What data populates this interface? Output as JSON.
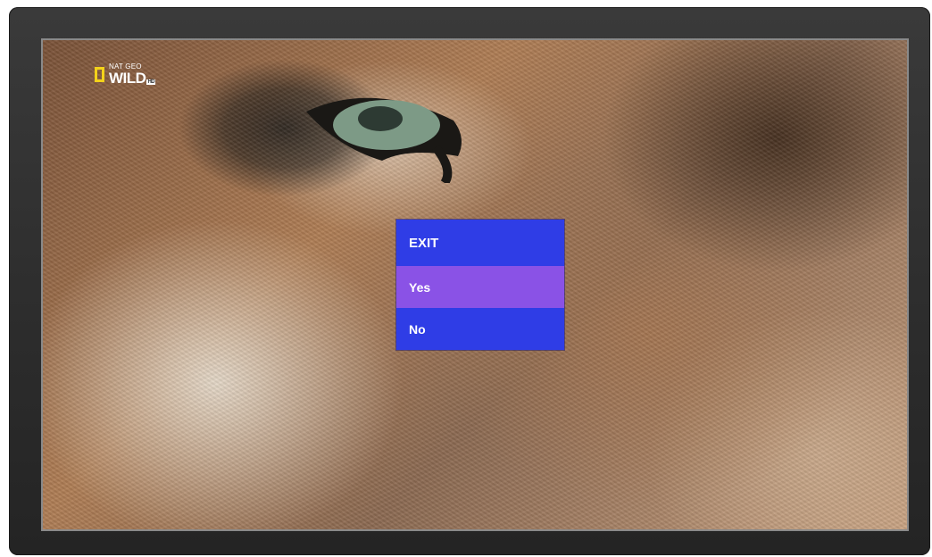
{
  "channel_logo": {
    "small_text": "NAT GEO",
    "main_text": "WILD",
    "badge": "HD",
    "frame_color": "#f3d21a"
  },
  "exit_dialog": {
    "title": "EXIT",
    "options": [
      {
        "label": "Yes",
        "selected": true
      },
      {
        "label": "No",
        "selected": false
      }
    ],
    "background_color": "#2f3de6",
    "highlight_color": "#8a52e6"
  }
}
